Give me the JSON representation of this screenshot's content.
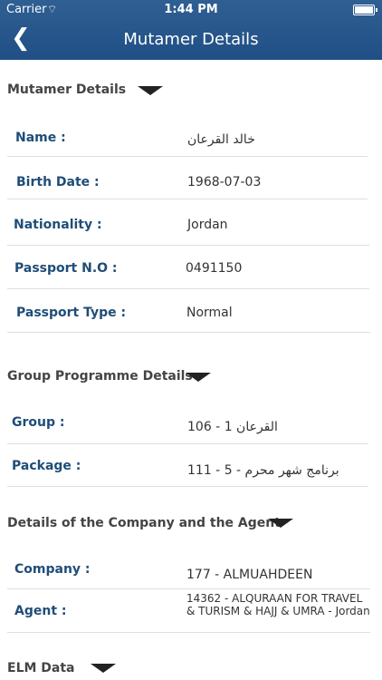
{
  "status": {
    "carrier": "Carrier",
    "time": "1:44 PM",
    "battery_level": 1.0
  },
  "nav": {
    "title": "Mutamer Details"
  },
  "sections": {
    "mutamer": "Mutamer Details",
    "group": "Group Programme Details",
    "company": "Details of the Company and the Agent",
    "elm": "ELM Data"
  },
  "mutamer": {
    "name_label": "Name :",
    "name_value": "خالد القرعان",
    "birth_label": "Birth Date :",
    "birth_value": "1968-07-03",
    "nationality_label": "Nationality :",
    "nationality_value": "Jordan",
    "passport_label": "Passport N.O :",
    "passport_value": "0491150",
    "passport_type_label": "Passport Type :",
    "passport_type_value": "Normal"
  },
  "group": {
    "group_label": "Group :",
    "group_value": "106 - القرعان 1",
    "package_label": "Package :",
    "package_value": "111 - برنامج شهر محرم - 5"
  },
  "company": {
    "company_label": "Company :",
    "company_value": "177 - ALMUAHDEEN",
    "agent_label": "Agent :",
    "agent_line1": "14362 - ALQURAAN FOR TRAVEL",
    "agent_line2": "& TURISM & HAJJ & UMRA - Jordan"
  }
}
